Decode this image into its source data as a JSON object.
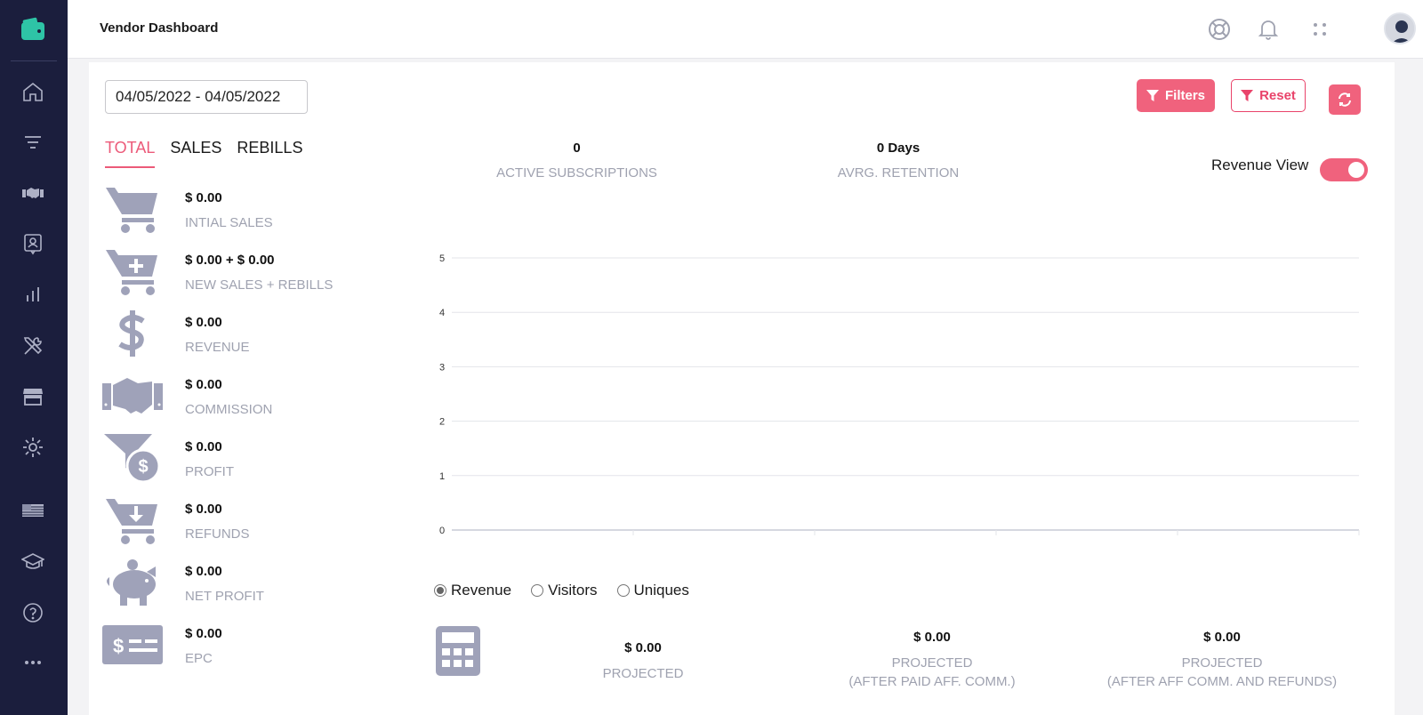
{
  "header": {
    "title": "Vendor Dashboard"
  },
  "colors": {
    "sidebar_bg": "#1b1e3d",
    "accent": "#f0627d",
    "muted_text": "#9fa2b0",
    "icon_gray": "#9fa2b9",
    "logo_teal": "#2ec4a6"
  },
  "sidebar": {
    "items": [
      {
        "icon": "home-icon"
      },
      {
        "icon": "filter-lines-icon"
      },
      {
        "icon": "handshake-icon"
      },
      {
        "icon": "contact-card-icon"
      },
      {
        "icon": "bar-chart-icon"
      },
      {
        "icon": "tools-icon"
      },
      {
        "icon": "store-icon"
      },
      {
        "icon": "gear-icon"
      },
      {
        "icon": "us-flag-icon"
      },
      {
        "icon": "graduation-cap-icon"
      },
      {
        "icon": "help-icon"
      },
      {
        "icon": "more-icon"
      }
    ]
  },
  "toolbar": {
    "date_range": "04/05/2022 - 04/05/2022",
    "filters_label": "Filters",
    "reset_label": "Reset"
  },
  "tabs": [
    {
      "label": "TOTAL",
      "active": true
    },
    {
      "label": "SALES",
      "active": false
    },
    {
      "label": "REBILLS",
      "active": false
    }
  ],
  "metrics": [
    {
      "icon": "cart-icon",
      "value": "$ 0.00",
      "label": "INTIAL SALES"
    },
    {
      "icon": "cart-plus-icon",
      "value": "$ 0.00 + $ 0.00",
      "label": "NEW SALES + REBILLS"
    },
    {
      "icon": "dollar-icon",
      "value": "$ 0.00",
      "label": "REVENUE"
    },
    {
      "icon": "handshake-icon",
      "value": "$ 0.00",
      "label": "COMMISSION"
    },
    {
      "icon": "funnel-dollar-icon",
      "value": "$ 0.00",
      "label": "PROFIT"
    },
    {
      "icon": "cart-arrow-down-icon",
      "value": "$ 0.00",
      "label": "REFUNDS"
    },
    {
      "icon": "piggy-bank-icon",
      "value": "$ 0.00",
      "label": "NET PROFIT"
    },
    {
      "icon": "money-check-icon",
      "value": "$ 0.00",
      "label": "EPC"
    }
  ],
  "stats": {
    "active_subscriptions": {
      "value": "0",
      "label": "ACTIVE SUBSCRIPTIONS"
    },
    "avg_retention": {
      "value": "0 Days",
      "label": "AVRG. RETENTION"
    }
  },
  "revenue_view": {
    "label": "Revenue View",
    "on": true
  },
  "chart_data": {
    "type": "line",
    "title": "",
    "xlabel": "",
    "ylabel": "",
    "ylim": [
      0,
      5
    ],
    "yticks": [
      0,
      1,
      2,
      3,
      4,
      5
    ],
    "series": [
      {
        "values": []
      }
    ],
    "grid": true
  },
  "chart_options": [
    {
      "label": "Revenue",
      "checked": true
    },
    {
      "label": "Visitors",
      "checked": false
    },
    {
      "label": "Uniques",
      "checked": false
    }
  ],
  "projections": [
    {
      "value": "$ 0.00",
      "label": "PROJECTED",
      "sub": ""
    },
    {
      "value": "$ 0.00",
      "label": "PROJECTED",
      "sub": "(AFTER PAID AFF. COMM.)"
    },
    {
      "value": "$ 0.00",
      "label": "PROJECTED",
      "sub": "(AFTER AFF COMM. AND REFUNDS)"
    }
  ]
}
